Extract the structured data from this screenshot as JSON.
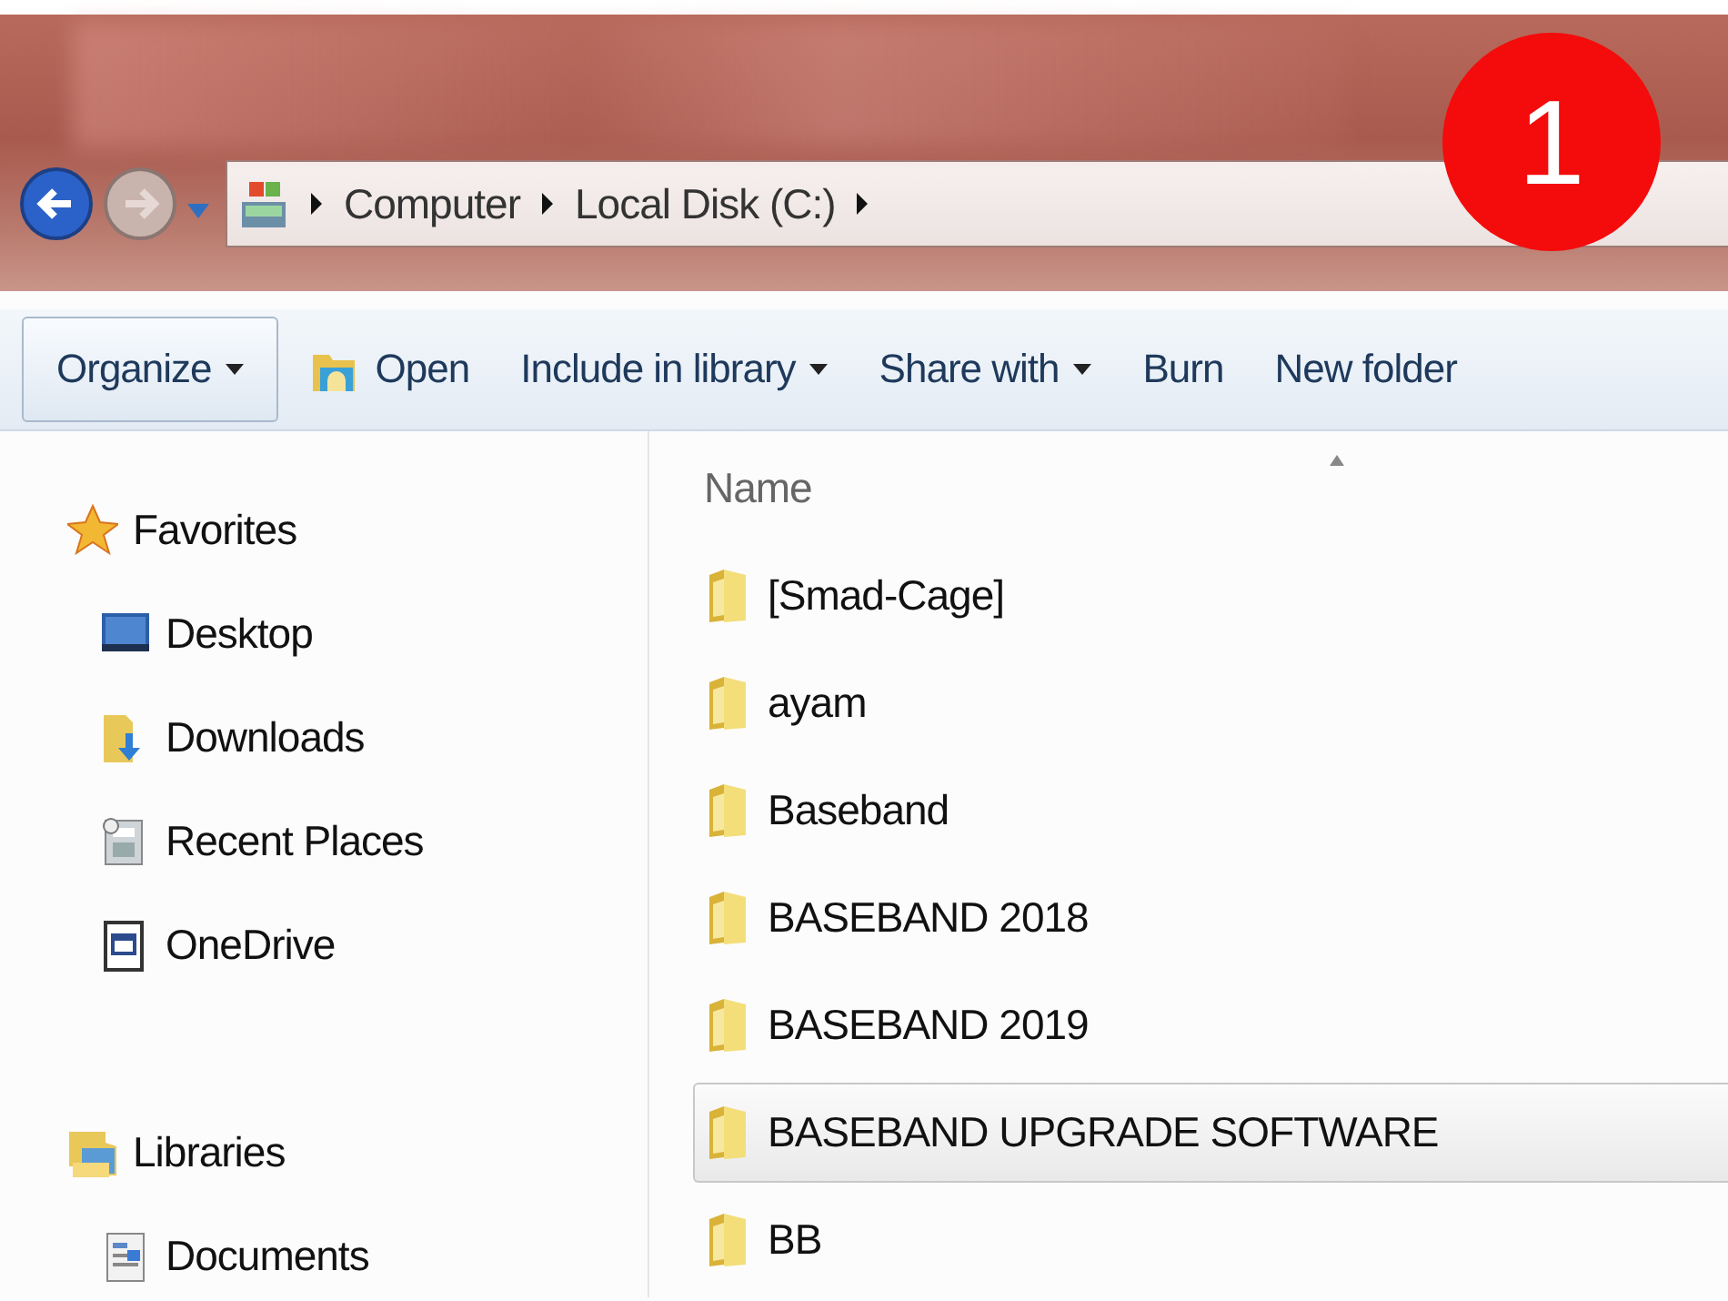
{
  "address": {
    "crumbs": [
      "Computer",
      "Local Disk (C:)"
    ]
  },
  "badge": "1",
  "toolbar": [
    {
      "label": "Organize",
      "dropdown": true,
      "kind": "framed"
    },
    {
      "label": "Open",
      "dropdown": false,
      "kind": "icon"
    },
    {
      "label": "Include in library",
      "dropdown": true,
      "kind": "plain"
    },
    {
      "label": "Share with",
      "dropdown": true,
      "kind": "plain"
    },
    {
      "label": "Burn",
      "dropdown": false,
      "kind": "plain"
    },
    {
      "label": "New folder",
      "dropdown": false,
      "kind": "plain"
    }
  ],
  "sidebar": {
    "groups": [
      {
        "label": "Favorites",
        "children": [
          {
            "label": "Desktop"
          },
          {
            "label": "Downloads"
          },
          {
            "label": "Recent Places"
          },
          {
            "label": "OneDrive"
          }
        ]
      },
      {
        "label": "Libraries",
        "children": [
          {
            "label": "Documents"
          }
        ]
      }
    ]
  },
  "file_list": {
    "columns": [
      "Name"
    ],
    "rows": [
      {
        "name": "[Smad-Cage]",
        "selected": false
      },
      {
        "name": "ayam",
        "selected": false
      },
      {
        "name": "Baseband",
        "selected": false
      },
      {
        "name": "BASEBAND 2018",
        "selected": false
      },
      {
        "name": "BASEBAND 2019",
        "selected": false
      },
      {
        "name": "BASEBAND UPGRADE SOFTWARE",
        "selected": true
      },
      {
        "name": "BB",
        "selected": false
      }
    ]
  }
}
